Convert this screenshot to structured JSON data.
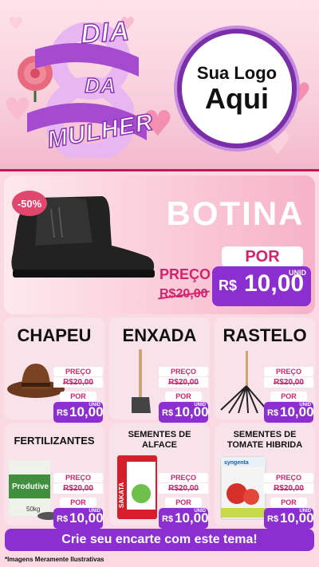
{
  "header": {
    "dia": "DIA",
    "da": "DA",
    "mulher": "MULHER",
    "logo_line1": "Sua Logo",
    "logo_line2": "Aqui"
  },
  "featured": {
    "discount_badge": "-50%",
    "name": "BOTINA",
    "preco_label": "PREÇO",
    "old_price": "R$20,00",
    "por_label": "POR",
    "currency": "R$",
    "price": "10,00",
    "unit": "UNID"
  },
  "products": [
    {
      "name": "CHAPEU",
      "preco_label": "PREÇO",
      "old_price": "R$20,00",
      "por_label": "POR",
      "currency": "R$",
      "price": "10,00",
      "unit": "UNID"
    },
    {
      "name": "ENXADA",
      "preco_label": "PREÇO",
      "old_price": "R$20,00",
      "por_label": "POR",
      "currency": "R$",
      "price": "10,00",
      "unit": "UNID"
    },
    {
      "name": "RASTELO",
      "preco_label": "PREÇO",
      "old_price": "R$20,00",
      "por_label": "POR",
      "currency": "R$",
      "price": "10,00",
      "unit": "UNID"
    },
    {
      "name": "FERTILIZANTES",
      "preco_label": "PREÇO",
      "old_price": "R$20,00",
      "por_label": "POR",
      "currency": "R$",
      "price": "10,00",
      "unit": "UNID",
      "package_text": "Produtive",
      "package_weight": "50kg"
    },
    {
      "name": "SEMENTES DE ALFACE",
      "preco_label": "PREÇO",
      "old_price": "R$20,00",
      "por_label": "POR",
      "currency": "R$",
      "price": "10,00",
      "unit": "UNID",
      "package_text": "SAKATA"
    },
    {
      "name": "SEMENTES DE TOMATE HIBRIDA",
      "preco_label": "PREÇO",
      "old_price": "R$20,00",
      "por_label": "POR",
      "currency": "R$",
      "price": "10,00",
      "unit": "UNID",
      "package_text": "syngenta"
    }
  ],
  "cta": "Crie seu encarte com este tema!",
  "footer_note": "*Imagens Meramente Ilustrativas",
  "colors": {
    "purple": "#8b2fd0",
    "pink_accent": "#d2236c",
    "background": "#fbd9e3"
  }
}
